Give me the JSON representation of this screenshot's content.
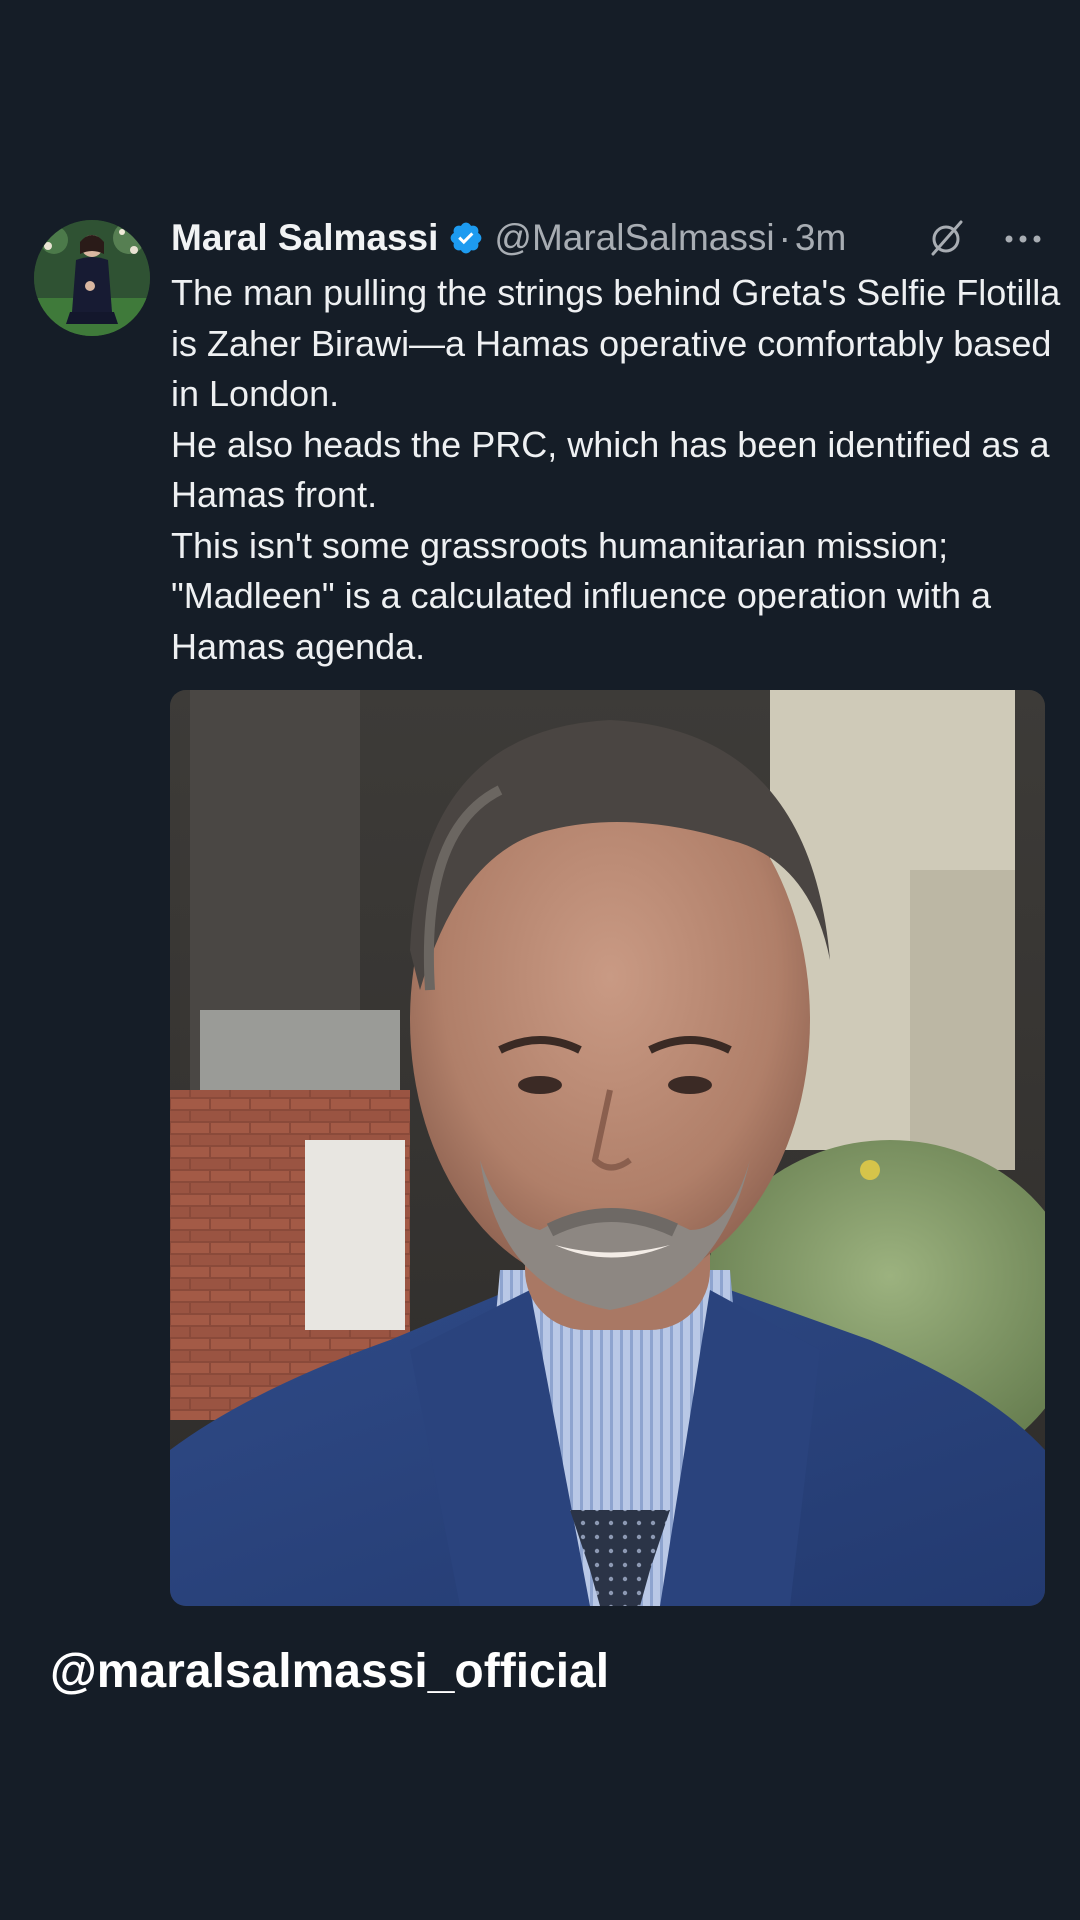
{
  "tweet": {
    "author": {
      "display_name": "Maral Salmassi",
      "verified": true,
      "handle": "@MaralSalmassi",
      "avatar_icon": "profile-photo"
    },
    "separator": "·",
    "timestamp": "3m",
    "actions": {
      "grok_icon": "grok-icon",
      "more_icon": "more-options-icon"
    },
    "body_lines": [
      "The man pulling the strings behind Greta's Selfie Flotilla is Zaher Birawi—a Hamas operative comfortably based in London.",
      "He also heads the PRC, which has been identified as a Hamas front.",
      "This isn't some grassroots humanitarian mission; \"Madleen\" is a calculated influence operation with a Hamas agenda."
    ],
    "media": {
      "type": "photo"
    }
  },
  "watermark": "@maralsalmassi_official",
  "colors": {
    "background": "#151d27",
    "text_primary": "#eef0f2",
    "text_secondary": "#a8adb3",
    "verified_blue": "#1d9bf0"
  }
}
